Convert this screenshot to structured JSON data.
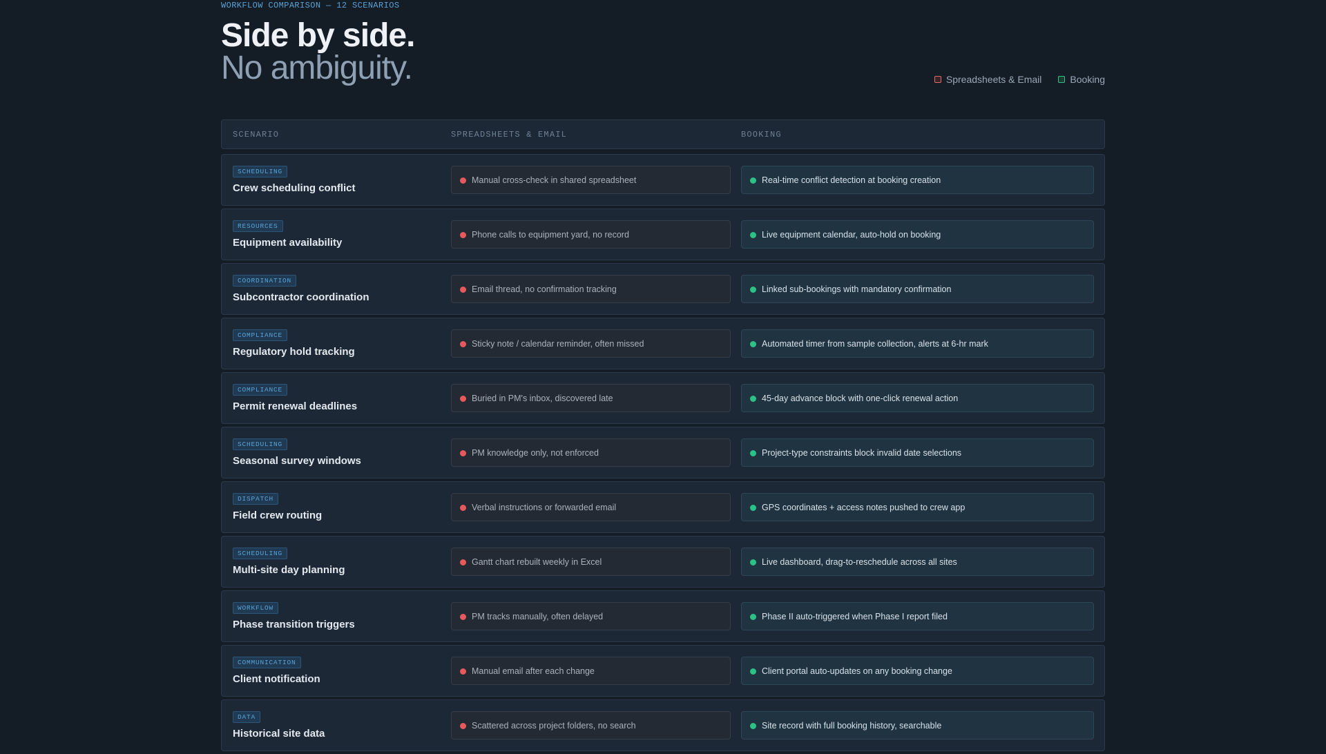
{
  "header": {
    "eyebrow": "WORKFLOW COMPARISON — 12 SCENARIOS",
    "title_line1": "Side by side.",
    "title_line2": "No ambiguity."
  },
  "legend": {
    "old_label": "Spreadsheets & Email",
    "new_label": "Booking",
    "old_color": "#e86a6a",
    "new_color": "#33c28a"
  },
  "table": {
    "columns": [
      "SCENARIO",
      "SPREADSHEETS & EMAIL",
      "BOOKING"
    ],
    "rows": [
      {
        "tag": "SCHEDULING",
        "scenario": "Crew scheduling conflict",
        "old": "Manual cross-check in shared spreadsheet",
        "new": "Real-time conflict detection at booking creation"
      },
      {
        "tag": "RESOURCES",
        "scenario": "Equipment availability",
        "old": "Phone calls to equipment yard, no record",
        "new": "Live equipment calendar, auto-hold on booking"
      },
      {
        "tag": "COORDINATION",
        "scenario": "Subcontractor coordination",
        "old": "Email thread, no confirmation tracking",
        "new": "Linked sub-bookings with mandatory confirmation"
      },
      {
        "tag": "COMPLIANCE",
        "scenario": "Regulatory hold tracking",
        "old": "Sticky note / calendar reminder, often missed",
        "new": "Automated timer from sample collection, alerts at 6-hr mark"
      },
      {
        "tag": "COMPLIANCE",
        "scenario": "Permit renewal deadlines",
        "old": "Buried in PM's inbox, discovered late",
        "new": "45-day advance block with one-click renewal action"
      },
      {
        "tag": "SCHEDULING",
        "scenario": "Seasonal survey windows",
        "old": "PM knowledge only, not enforced",
        "new": "Project-type constraints block invalid date selections"
      },
      {
        "tag": "DISPATCH",
        "scenario": "Field crew routing",
        "old": "Verbal instructions or forwarded email",
        "new": "GPS coordinates + access notes pushed to crew app"
      },
      {
        "tag": "SCHEDULING",
        "scenario": "Multi-site day planning",
        "old": "Gantt chart rebuilt weekly in Excel",
        "new": "Live dashboard, drag-to-reschedule across all sites"
      },
      {
        "tag": "WORKFLOW",
        "scenario": "Phase transition triggers",
        "old": "PM tracks manually, often delayed",
        "new": "Phase II auto-triggered when Phase I report filed"
      },
      {
        "tag": "COMMUNICATION",
        "scenario": "Client notification",
        "old": "Manual email after each change",
        "new": "Client portal auto-updates on any booking change"
      },
      {
        "tag": "DATA",
        "scenario": "Historical site data",
        "old": "Scattered across project folders, no search",
        "new": "Site record with full booking history, searchable"
      }
    ]
  }
}
